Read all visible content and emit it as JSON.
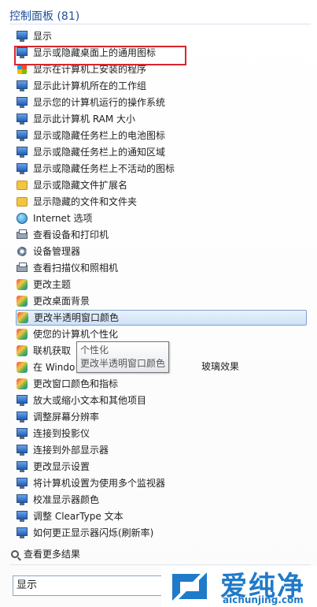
{
  "header": {
    "title": "控制面板 (81)"
  },
  "items": [
    {
      "label": "显示",
      "icon": "monitor-icon"
    },
    {
      "label": "显示或隐藏桌面上的通用图标",
      "icon": "monitor-icon"
    },
    {
      "label": "显示在计算机上安装的程序",
      "icon": "programs-icon"
    },
    {
      "label": "显示此计算机所在的工作组",
      "icon": "monitor-icon"
    },
    {
      "label": "显示您的计算机运行的操作系统",
      "icon": "monitor-icon"
    },
    {
      "label": "显示此计算机 RAM 大小",
      "icon": "monitor-icon"
    },
    {
      "label": "显示或隐藏任务栏上的电池图标",
      "icon": "taskbar-icon"
    },
    {
      "label": "显示或隐藏任务栏上的通知区域",
      "icon": "taskbar-icon"
    },
    {
      "label": "显示或隐藏任务栏上不活动的图标",
      "icon": "taskbar-icon"
    },
    {
      "label": "显示或隐藏文件扩展名",
      "icon": "folder-icon"
    },
    {
      "label": "显示隐藏的文件和文件夹",
      "icon": "folder-icon"
    },
    {
      "label": "Internet 选项",
      "icon": "globe-icon"
    },
    {
      "label": "查看设备和打印机",
      "icon": "printer-icon"
    },
    {
      "label": "设备管理器",
      "icon": "gear-icon"
    },
    {
      "label": "查看扫描仪和照相机",
      "icon": "printer-icon"
    },
    {
      "label": "更改主题",
      "icon": "personalize-icon"
    },
    {
      "label": "更改桌面背景",
      "icon": "personalize-icon"
    },
    {
      "label": "更改半透明窗口颜色",
      "icon": "personalize-icon"
    },
    {
      "label": "使您的计算机个性化",
      "icon": "personalize-icon"
    },
    {
      "label": "联机获取",
      "icon": "personalize-icon"
    },
    {
      "label": "在 Windo",
      "icon": "personalize-icon"
    },
    {
      "label": "更改窗口颜色和指标",
      "icon": "personalize-icon"
    },
    {
      "label": "放大或缩小文本和其他项目",
      "icon": "monitor-icon"
    },
    {
      "label": "调整屏幕分辨率",
      "icon": "monitor-icon"
    },
    {
      "label": "连接到投影仪",
      "icon": "monitor-icon"
    },
    {
      "label": "连接到外部显示器",
      "icon": "monitor-icon"
    },
    {
      "label": "更改显示设置",
      "icon": "monitor-icon"
    },
    {
      "label": "将计算机设置为使用多个监视器",
      "icon": "monitor-icon"
    },
    {
      "label": "校准显示器颜色",
      "icon": "monitor-icon"
    },
    {
      "label": "调整 ClearType 文本",
      "icon": "monitor-icon"
    },
    {
      "label": "如何更正显示器闪烁(刷新率)",
      "icon": "monitor-icon"
    }
  ],
  "selected_index": 17,
  "tooltip": {
    "line1": "个性化",
    "line2": "更改半透明窗口颜色"
  },
  "overlay_text": "玻璃效果",
  "search_more": "查看更多结果",
  "search": {
    "value": "显示"
  },
  "watermark": {
    "title": "爱纯净",
    "url": "aichunjing.com"
  },
  "colors": {
    "accent": "#1e4f9c",
    "highlight_box": "#d9252b",
    "watermark": "#1f7ac9"
  }
}
